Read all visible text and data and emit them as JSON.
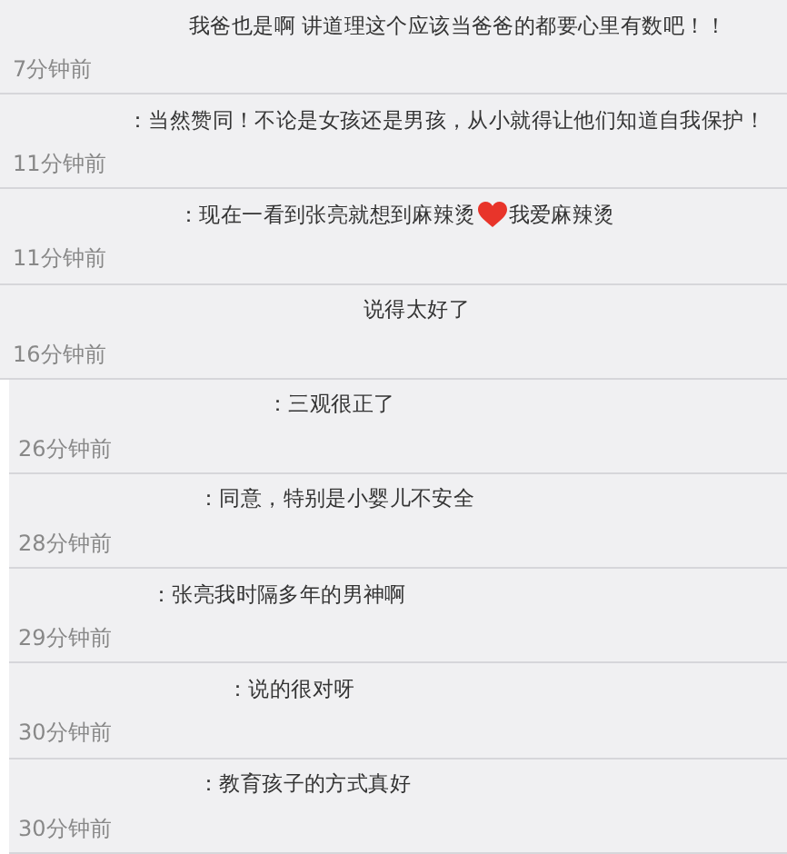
{
  "comments": [
    {
      "text": "我爸也是啊 讲道理这个应该当爸爸的都要心里有数吧！！",
      "time": "7分钟前"
    },
    {
      "text": "：当然赞同！不论是女孩还是男孩，从小就得让他们知道自我保护！",
      "time": "11分钟前"
    },
    {
      "text": "：现在一看到张亮就想到麻辣烫",
      "text_after": "我爱麻辣烫",
      "time": "11分钟前"
    },
    {
      "text": "说得太好了",
      "time": "16分钟前"
    },
    {
      "text": "：三观很正了",
      "time": "26分钟前"
    },
    {
      "text": "：同意，特别是小婴儿不安全",
      "time": "28分钟前"
    },
    {
      "text": "：张亮我时隔多年的男神啊",
      "time": "29分钟前"
    },
    {
      "text": "：说的很对呀",
      "time": "30分钟前"
    },
    {
      "text": "：教育孩子的方式真好",
      "time": "30分钟前"
    }
  ]
}
